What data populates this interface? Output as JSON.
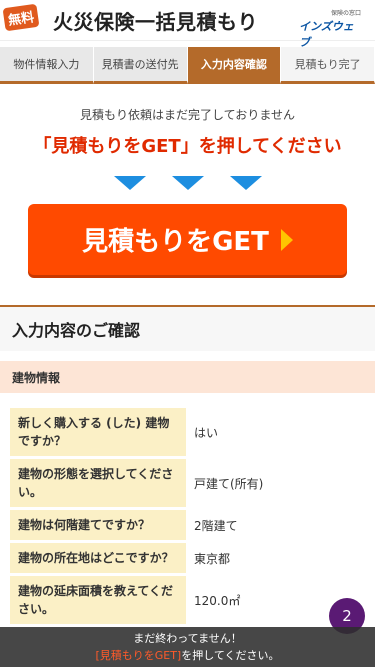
{
  "header": {
    "badge": "無料",
    "title": "火災保険一括見積もり",
    "logo_sub": "保険の窓口",
    "logo_main": "インズウェブ"
  },
  "steps": [
    {
      "label": "物件情報入力",
      "state": "done"
    },
    {
      "label": "見積書の送付先",
      "state": "done"
    },
    {
      "label": "入力内容確認",
      "state": "active"
    },
    {
      "label": "見積もり完了",
      "state": "todo"
    }
  ],
  "notice": {
    "text": "見積もり依頼はまだ完了しておりません",
    "cta_text": "「見積もりをGET」を押してください"
  },
  "get_button": {
    "label": "見積もりをGET"
  },
  "section": {
    "title": "入力内容のご確認",
    "subhead": "建物情報"
  },
  "rows": [
    {
      "q": "新しく購入する (した) 建物ですか？",
      "a": "はい"
    },
    {
      "q": "建物の形態を選択してください。",
      "a": "戸建て(所有)"
    },
    {
      "q": "建物は何階建てですか？",
      "a": "2階建て"
    },
    {
      "q": "建物の所在地はどこですか？",
      "a": "東京都"
    },
    {
      "q": "建物の延床面積を教えてください。",
      "a": "120.0㎡"
    }
  ],
  "footer": {
    "line1": "まだ終わってません！",
    "line2_highlight": "[見積もりをGET]",
    "line2_rest": "を押してください。"
  },
  "chat_fab": {
    "count": "2"
  },
  "colors": {
    "accent": "#ff4a00",
    "brown": "#b46a2a",
    "arrow_blue": "#1d8ee0",
    "fab": "#5a1a74"
  }
}
